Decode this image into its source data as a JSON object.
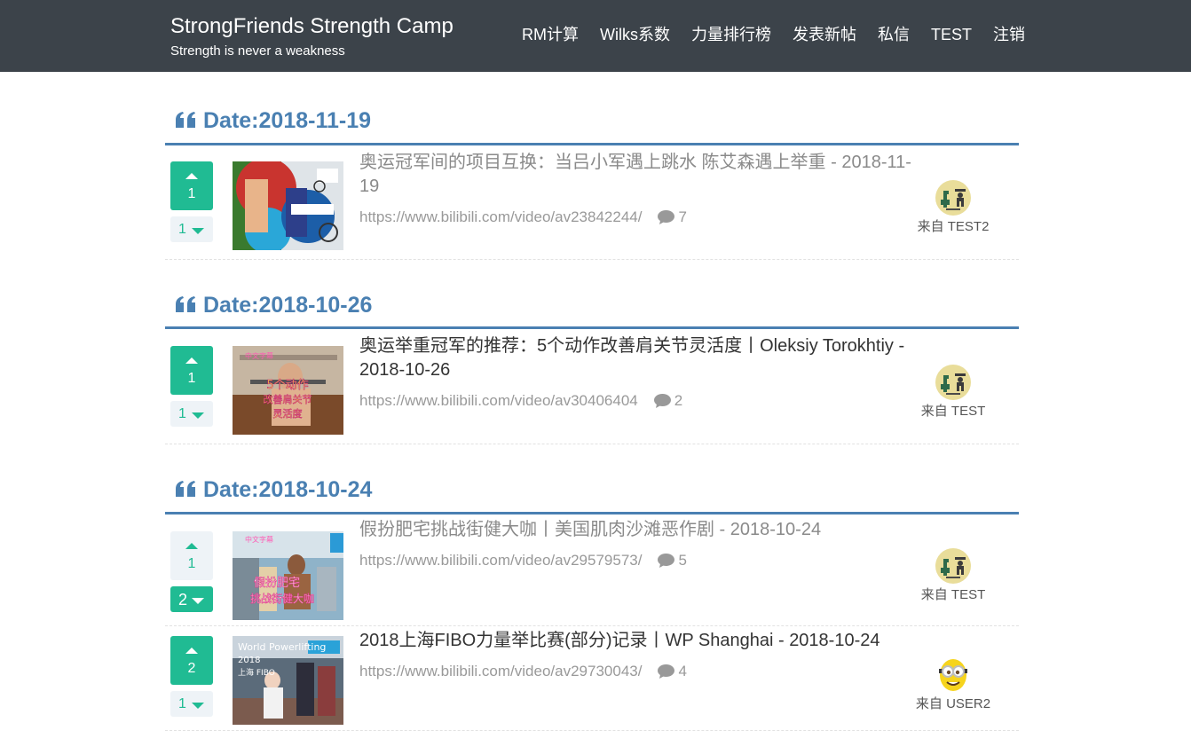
{
  "header": {
    "brand_title": "StrongFriends Strength Camp",
    "brand_subtitle": "Strength is never a weakness",
    "nav": [
      "RM计算",
      "Wilks系数",
      "力量排行榜",
      "发表新帖",
      "私信",
      "TEST",
      "注销"
    ]
  },
  "colors": {
    "navbar": "#3c434a",
    "accent_blue": "#4a80b2",
    "vote_green": "#20bb93",
    "vote_idle": "#eef3f7"
  },
  "groups": [
    {
      "date": "Date:2018-11-19",
      "posts": [
        {
          "up": "1",
          "down": "1",
          "up_active": true,
          "down_active": false,
          "title": "奥运冠军间的项目互换：当吕小军遇上跳水 陈艾森遇上举重 - 2018-11-19",
          "visited": true,
          "url": "https://www.bilibili.com/video/av23842244/",
          "comments": "7",
          "author": "来自 TEST2",
          "avatar": "fitness-avatar-icon"
        }
      ]
    },
    {
      "date": "Date:2018-10-26",
      "posts": [
        {
          "up": "1",
          "down": "1",
          "up_active": true,
          "down_active": false,
          "title": "奥运举重冠军的推荐：5个动作改善肩关节灵活度丨Oleksiy Torokhtiy - 2018-10-26",
          "visited": false,
          "url": "https://www.bilibili.com/video/av30406404",
          "comments": "2",
          "author": "来自 TEST",
          "avatar": "fitness-avatar-icon"
        }
      ]
    },
    {
      "date": "Date:2018-10-24",
      "posts": [
        {
          "up": "1",
          "down": "2",
          "up_active": false,
          "down_active": true,
          "title": "假扮肥宅挑战街健大咖丨美国肌肉沙滩恶作剧 - 2018-10-24",
          "visited": true,
          "url": "https://www.bilibili.com/video/av29579573/",
          "comments": "5",
          "author": "来自 TEST",
          "avatar": "fitness-avatar-icon"
        },
        {
          "up": "2",
          "down": "1",
          "up_active": true,
          "down_active": false,
          "title": "2018上海FIBO力量举比赛(部分)记录丨WP Shanghai - 2018-10-24",
          "visited": false,
          "url": "https://www.bilibili.com/video/av29730043/",
          "comments": "4",
          "author": "来自 USER2",
          "avatar": "minion-avatar-icon"
        }
      ]
    }
  ]
}
